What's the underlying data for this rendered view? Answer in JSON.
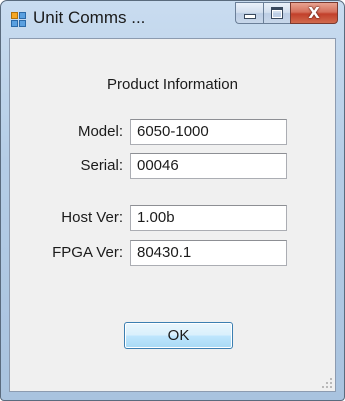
{
  "window": {
    "title": "Unit Comms ...",
    "icon": "app-window-icon",
    "controls": {
      "minimize": "minimize-icon",
      "maximize": "maximize-icon",
      "close_glyph": "X"
    }
  },
  "dialog": {
    "heading": "Product Information",
    "fields": [
      {
        "label": "Model:",
        "value": "6050-1000"
      },
      {
        "label": "Serial:",
        "value": "00046"
      },
      {
        "label": "Host Ver:",
        "value": "1.00b"
      },
      {
        "label": "FPGA Ver:",
        "value": "80430.1"
      }
    ],
    "ok_label": "OK"
  },
  "colors": {
    "frame": "#b5cde6",
    "client_bg": "#f0f0f0",
    "close_button": "#c2402b",
    "ok_button_border": "#3c7fb1"
  }
}
